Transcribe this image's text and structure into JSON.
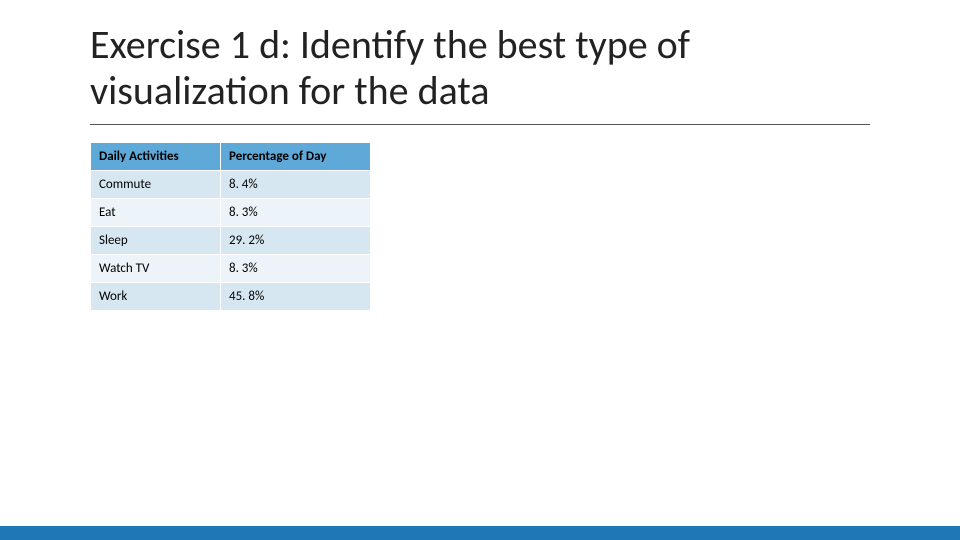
{
  "title": "Exercise 1 d: Identify the best type of visualization for the data",
  "table": {
    "headers": {
      "activity": "Daily Activities",
      "percent": "Percentage of Day"
    },
    "rows": [
      {
        "activity": "Commute",
        "percent": "8. 4%"
      },
      {
        "activity": "Eat",
        "percent": "8. 3%"
      },
      {
        "activity": "Sleep",
        "percent": "29. 2%"
      },
      {
        "activity": "Watch TV",
        "percent": "8. 3%"
      },
      {
        "activity": "Work",
        "percent": "45. 8%"
      }
    ]
  },
  "colors": {
    "header_bg": "#5fa9d8",
    "row_odd_bg": "#d6e7f2",
    "row_even_bg": "#ecf3f9",
    "accent_band": "#1f78b6"
  },
  "chart_data": {
    "type": "table",
    "title": "Exercise 1 d: Identify the best type of visualization for the data",
    "columns": [
      "Daily Activities",
      "Percentage of Day"
    ],
    "categories": [
      "Commute",
      "Eat",
      "Sleep",
      "Watch TV",
      "Work"
    ],
    "values": [
      8.4,
      8.3,
      29.2,
      8.3,
      45.8
    ],
    "ylabel": "Percentage of Day",
    "xlabel": "Daily Activities",
    "ylim": [
      0,
      100
    ]
  }
}
